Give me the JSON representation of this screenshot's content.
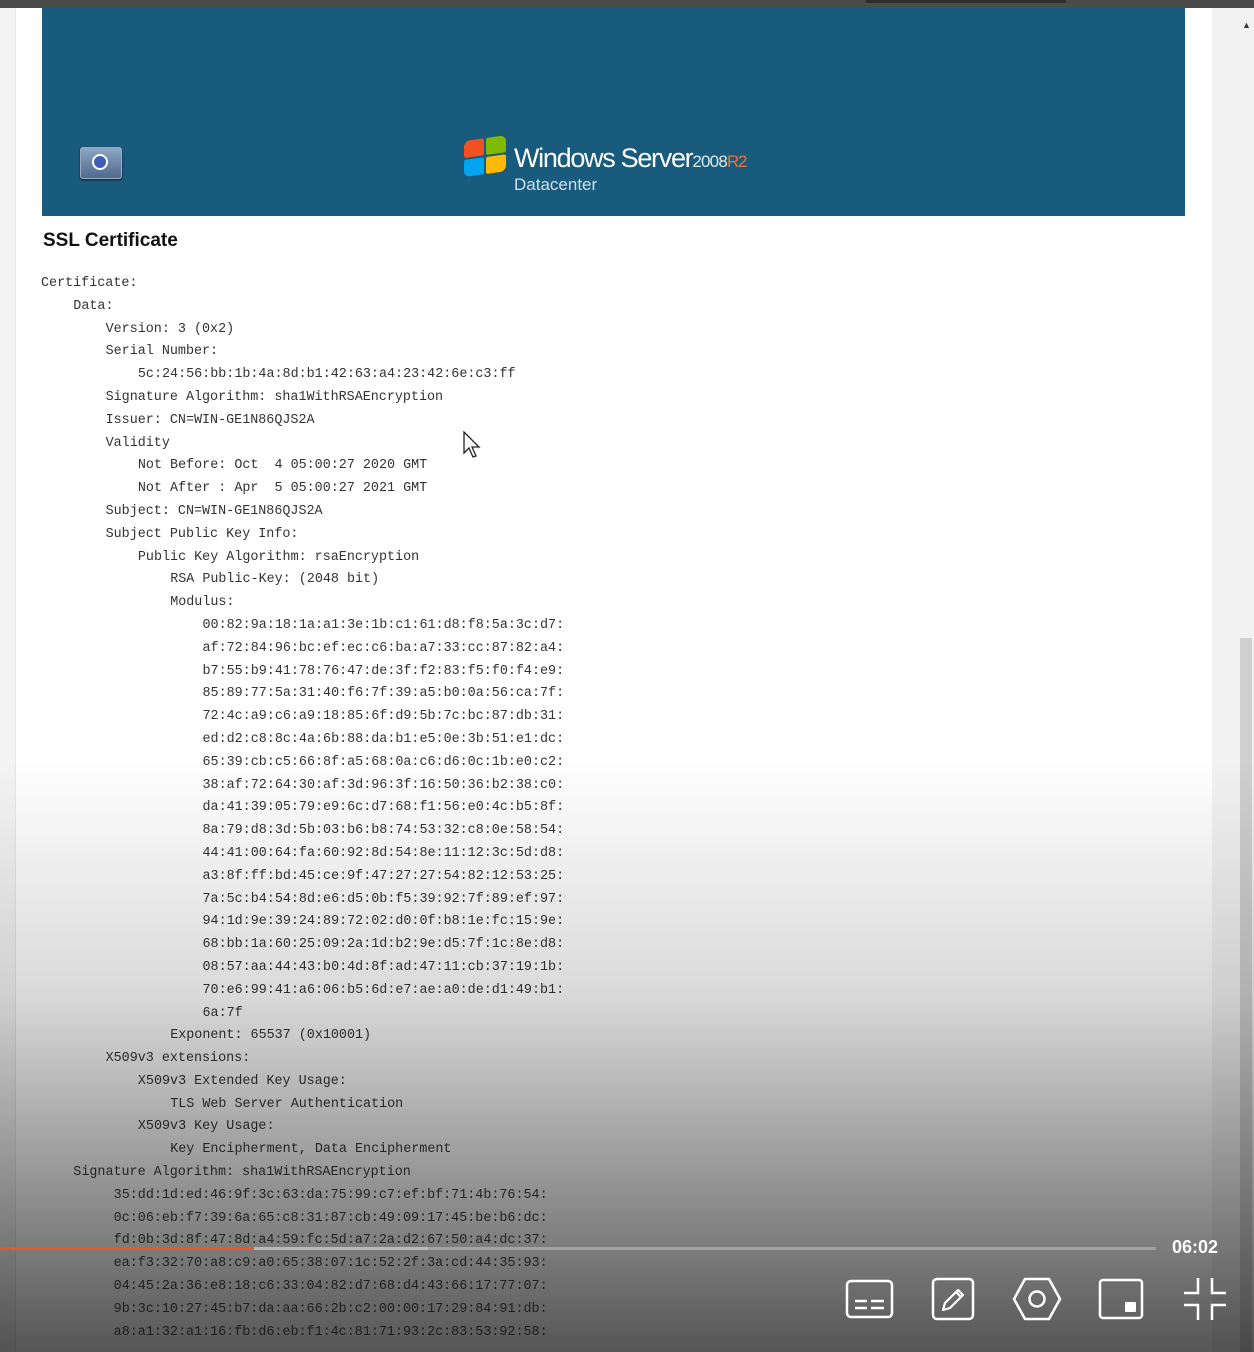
{
  "banner": {
    "logo_text": "Windows Server",
    "logo_version": "2008",
    "logo_release": "R2",
    "logo_edition": "Datacenter"
  },
  "page_title": "SSL Certificate",
  "certificate_lines": [
    {
      "indent": 0,
      "text": "Certificate:"
    },
    {
      "indent": 1,
      "text": "Data:"
    },
    {
      "indent": 2,
      "text": "Version: 3 (0x2)"
    },
    {
      "indent": 2,
      "text": "Serial Number:"
    },
    {
      "indent": 3,
      "text": "5c:24:56:bb:1b:4a:8d:b1:42:63:a4:23:42:6e:c3:ff"
    },
    {
      "indent": 2,
      "text": "Signature Algorithm: sha1WithRSAEncryption"
    },
    {
      "indent": 2,
      "text": "Issuer: CN=WIN-GE1N86QJS2A"
    },
    {
      "indent": 2,
      "text": "Validity"
    },
    {
      "indent": 3,
      "text": "Not Before: Oct  4 05:00:27 2020 GMT"
    },
    {
      "indent": 3,
      "text": "Not After : Apr  5 05:00:27 2021 GMT"
    },
    {
      "indent": 2,
      "text": "Subject: CN=WIN-GE1N86QJS2A"
    },
    {
      "indent": 2,
      "text": "Subject Public Key Info:"
    },
    {
      "indent": 3,
      "text": "Public Key Algorithm: rsaEncryption"
    },
    {
      "indent": 4,
      "text": "RSA Public-Key: (2048 bit)"
    },
    {
      "indent": 4,
      "text": "Modulus:"
    },
    {
      "indent": 5,
      "text": "00:82:9a:18:1a:a1:3e:1b:c1:61:d8:f8:5a:3c:d7:"
    },
    {
      "indent": 5,
      "text": "af:72:84:96:bc:ef:ec:c6:ba:a7:33:cc:87:82:a4:"
    },
    {
      "indent": 5,
      "text": "b7:55:b9:41:78:76:47:de:3f:f2:83:f5:f0:f4:e9:"
    },
    {
      "indent": 5,
      "text": "85:89:77:5a:31:40:f6:7f:39:a5:b0:0a:56:ca:7f:"
    },
    {
      "indent": 5,
      "text": "72:4c:a9:c6:a9:18:85:6f:d9:5b:7c:bc:87:db:31:"
    },
    {
      "indent": 5,
      "text": "ed:d2:c8:8c:4a:6b:88:da:b1:e5:0e:3b:51:e1:dc:"
    },
    {
      "indent": 5,
      "text": "65:39:cb:c5:66:8f:a5:68:0a:c6:d6:0c:1b:e0:c2:"
    },
    {
      "indent": 5,
      "text": "38:af:72:64:30:af:3d:96:3f:16:50:36:b2:38:c0:"
    },
    {
      "indent": 5,
      "text": "da:41:39:05:79:e9:6c:d7:68:f1:56:e0:4c:b5:8f:"
    },
    {
      "indent": 5,
      "text": "8a:79:d8:3d:5b:03:b6:b8:74:53:32:c8:0e:58:54:"
    },
    {
      "indent": 5,
      "text": "44:41:00:64:fa:60:92:8d:54:8e:11:12:3c:5d:d8:"
    },
    {
      "indent": 5,
      "text": "a3:8f:ff:bd:45:ce:9f:47:27:27:54:82:12:53:25:"
    },
    {
      "indent": 5,
      "text": "7a:5c:b4:54:8d:e6:d5:0b:f5:39:92:7f:89:ef:97:"
    },
    {
      "indent": 5,
      "text": "94:1d:9e:39:24:89:72:02:d0:0f:b8:1e:fc:15:9e:"
    },
    {
      "indent": 5,
      "text": "68:bb:1a:60:25:09:2a:1d:b2:9e:d5:7f:1c:8e:d8:"
    },
    {
      "indent": 5,
      "text": "08:57:aa:44:43:b0:4d:8f:ad:47:11:cb:37:19:1b:"
    },
    {
      "indent": 5,
      "text": "70:e6:99:41:a6:06:b5:6d:e7:ae:a0:de:d1:49:b1:"
    },
    {
      "indent": 5,
      "text": "6a:7f"
    },
    {
      "indent": 4,
      "text": "Exponent: 65537 (0x10001)"
    },
    {
      "indent": 2,
      "text": "X509v3 extensions:"
    },
    {
      "indent": 3,
      "text": "X509v3 Extended Key Usage:"
    },
    {
      "indent": 4,
      "text": "TLS Web Server Authentication"
    },
    {
      "indent": 3,
      "text": "X509v3 Key Usage:"
    },
    {
      "indent": 4,
      "text": "Key Encipherment, Data Encipherment"
    },
    {
      "indent": 1,
      "text": "Signature Algorithm: sha1WithRSAEncryption"
    },
    {
      "indent": 2.25,
      "text": "35:dd:1d:ed:46:9f:3c:63:da:75:99:c7:ef:bf:71:4b:76:54:"
    },
    {
      "indent": 2.25,
      "text": "0c:06:eb:f7:39:6a:65:c8:31:87:cb:49:09:17:45:be:b6:dc:"
    },
    {
      "indent": 2.25,
      "text": "fd:0b:3d:8f:47:8d:a4:59:fc:5d:a7:2a:d2:67:50:a4:dc:37:"
    },
    {
      "indent": 2.25,
      "text": "ea:f3:32:70:a8:c9:a0:65:38:07:1c:52:2f:3a:cd:44:35:93:"
    },
    {
      "indent": 2.25,
      "text": "04:45:2a:36:e8:18:c6:33:04:82:d7:68:d4:43:66:17:77:07:"
    },
    {
      "indent": 2.25,
      "text": "9b:3c:10:27:45:b7:da:aa:66:2b:c2:00:00:17:29:84:91:db:"
    },
    {
      "indent": 2.25,
      "text": "a8:a1:32:a1:16:fb:d6:eb:f1:4c:81:71:93:2c:83:53:92:58:"
    }
  ],
  "player": {
    "time": "06:02",
    "played_fraction": 0.22,
    "buffered_fraction": 0.37,
    "accent_color": "#e8572c",
    "controls": [
      "subtitles-icon",
      "edit-icon",
      "settings-icon",
      "miniplayer-icon",
      "exit-fullscreen-icon"
    ]
  }
}
